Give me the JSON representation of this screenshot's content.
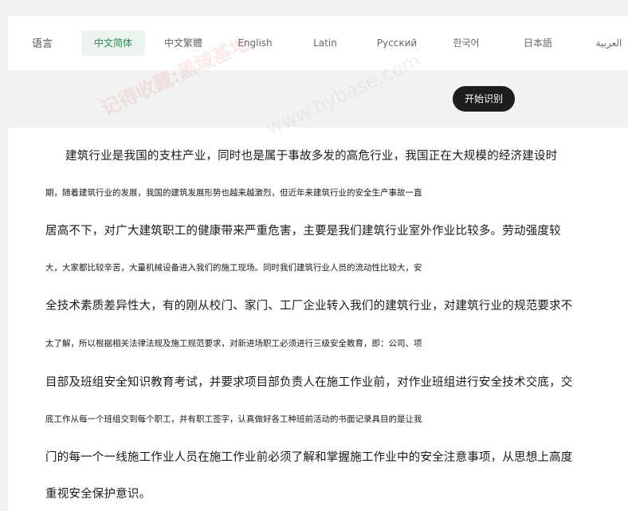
{
  "languages": {
    "label": "语言",
    "tabs": [
      "中文简体",
      "中文繁體",
      "English",
      "Latin",
      "Русский",
      "한국어",
      "日本語",
      "العربية"
    ]
  },
  "actions": {
    "start": "开始识别"
  },
  "watermark": {
    "cn": "记得收藏:黑域基地",
    "url": "www.hybase.com"
  },
  "document": {
    "lines": [
      "建筑行业是我国的支柱产业，同时也是属于事故多发的高危行业，我国正在大规模的经济建设时",
      "期，随着建筑行业的发展，我国的建筑发展形势也越来越激烈，但近年来建筑行业的安全生产事故一直",
      "居高不下，对广大建筑职工的健康带来严重危害，主要是我们建筑行业室外作业比较多。劳动强度较",
      "大，大家都比较辛苦，大量机械设备进入我们的施工现场。同时我们建筑行业人员的流动性比较大，安",
      "全技术素质差异性大，有的刚从校门、家门、工厂企业转入我们的建筑行业，对建筑行业的规范要求不",
      "太了解，所以根据相关法律法规及施工规范要求，对新进场职工必须进行三级安全教育，即：公司、项",
      "目部及班组安全知识教育考试，并要求项目部负责人在施工作业前，对作业班组进行安全技术交底，交",
      "底工作从每一个班组交到每个职工，并有职工签字，认真做好各工种班前活动的书面记录具目的是让我",
      "门的每一个一线施工作业人员在施工作业前必须了解和掌握施工作业中的安全注意事项，从思想上高度",
      "重视安全保护意识。"
    ]
  }
}
